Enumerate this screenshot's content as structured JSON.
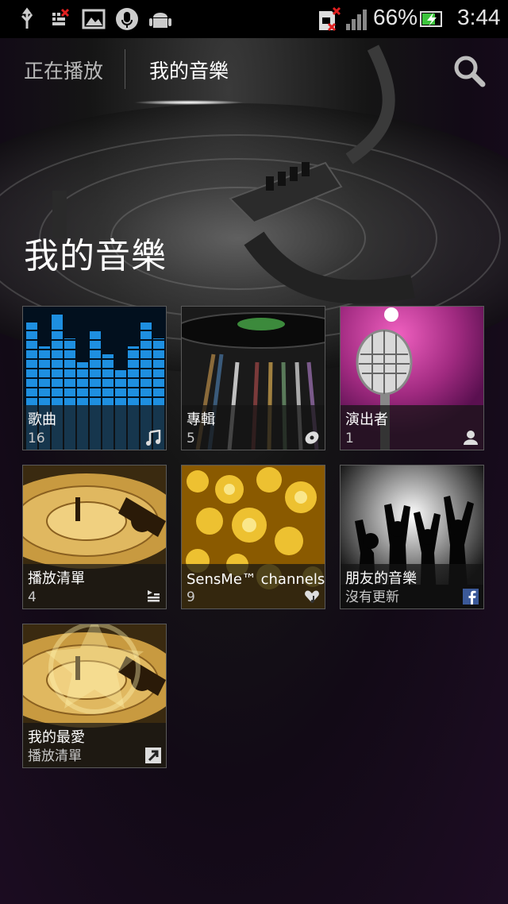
{
  "status_bar": {
    "battery_percent": "66%",
    "time": "3:44",
    "icons": [
      "usb-icon",
      "sim-error-icon",
      "gallery-icon",
      "microphone-icon",
      "android-icon",
      "sd-card-error-icon",
      "signal-icon",
      "battery-charging-icon"
    ]
  },
  "tabs": {
    "now_playing": "正在播放",
    "my_music": "我的音樂",
    "active": "my_music",
    "search_icon": "search-icon"
  },
  "page_title": "我的音樂",
  "tiles": [
    {
      "label": "歌曲",
      "sub": "16",
      "icon": "music-note-icon"
    },
    {
      "label": "專輯",
      "sub": "5",
      "icon": "disc-icon"
    },
    {
      "label": "演出者",
      "sub": "1",
      "icon": "person-icon"
    },
    {
      "label": "播放清單",
      "sub": "4",
      "icon": "playlist-icon"
    },
    {
      "label": "SensMe™ channels",
      "sub": "9",
      "icon": "heart-music-icon"
    },
    {
      "label": "朋友的音樂",
      "sub": "沒有更新",
      "icon": "facebook-icon"
    },
    {
      "label": "我的最愛",
      "sub": "播放清單",
      "icon": "shortcut-arrow-icon"
    }
  ],
  "colors": {
    "facebook_blue": "#3b5998",
    "mic_pink": "#d0338f",
    "eq_blue": "#1e8fe0",
    "gold": "#d9a030"
  }
}
